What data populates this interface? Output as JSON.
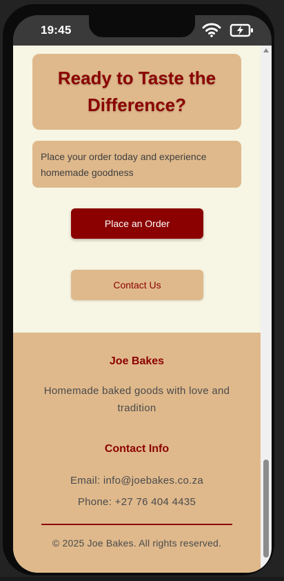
{
  "status_bar": {
    "time": "19:45",
    "icons": [
      "wifi-icon",
      "battery-charging-icon"
    ]
  },
  "cta": {
    "heading": "Ready to Taste the Difference?",
    "subtext": "Place your order today and experience homemade goodness",
    "primary_button": "Place an Order",
    "secondary_button": "Contact Us"
  },
  "footer": {
    "brand": "Joe Bakes",
    "tagline": "Homemade baked goods with love and tradition",
    "contact_title": "Contact Info",
    "email": "Email: info@joebakes.co.za",
    "phone": "Phone: +27 76 404 4435",
    "copyright": "© 2025 Joe Bakes. All rights reserved."
  },
  "colors": {
    "accent": "#8b0000",
    "card": "#dfb98c",
    "page_bg": "#f7f5e3"
  }
}
